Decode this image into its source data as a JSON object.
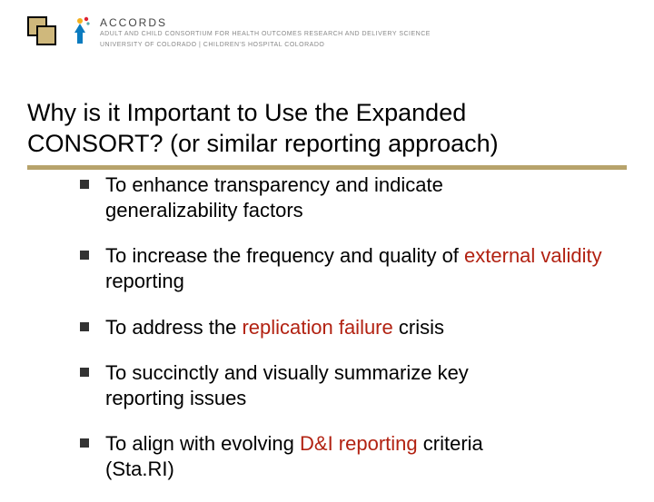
{
  "brand": {
    "name": "ACCORDS",
    "sub": "ADULT AND CHILD CONSORTIUM FOR HEALTH OUTCOMES RESEARCH AND DELIVERY SCIENCE",
    "org": "UNIVERSITY OF COLORADO  |  CHILDREN'S HOSPITAL COLORADO"
  },
  "title": {
    "line1": "Why is it Important to Use the Expanded",
    "line2": "CONSORT? (or similar reporting approach)"
  },
  "bullets": {
    "b1a": "To enhance transparency and indicate",
    "b1b": "generalizability factors",
    "b2a": "To increase the frequency and quality of ",
    "b2b_hl": "external validity",
    "b2c": " reporting",
    "b3a": "To address the ",
    "b3b_hl": "replication failure",
    "b3c": " crisis",
    "b4a": "To succinctly and visually summarize key",
    "b4b": "reporting issues",
    "b5a": "To align with evolving ",
    "b5b_hl": "D&I reporting",
    "b5c": " criteria",
    "b5d": "(Sta.RI)"
  }
}
